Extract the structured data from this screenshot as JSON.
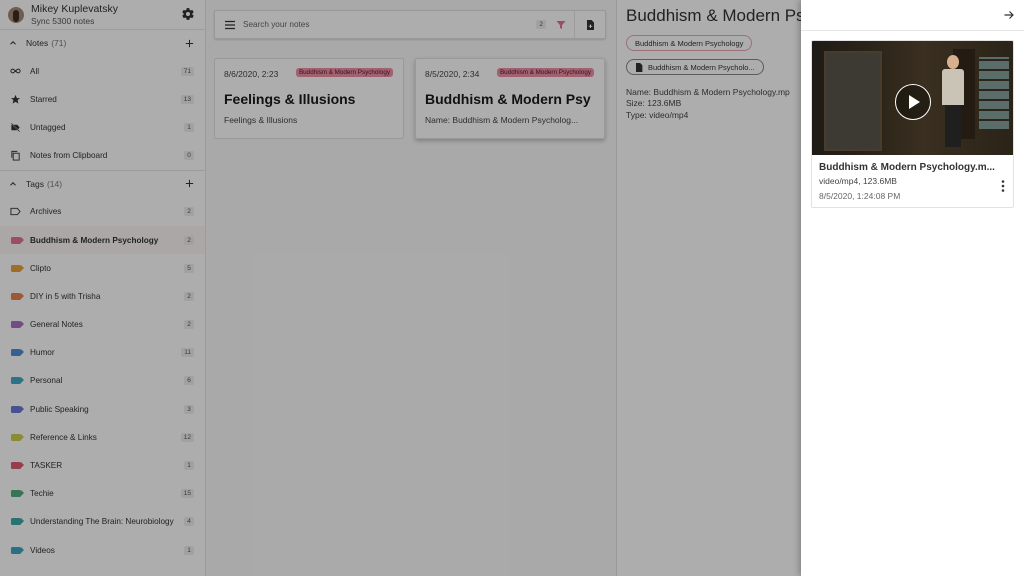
{
  "sidebar": {
    "profile": {
      "name": "Mikey Kuplevatsky",
      "sync": "Sync 5300 notes"
    },
    "notes_section": {
      "label": "Notes",
      "count": "(71)"
    },
    "notes_items": [
      {
        "label": "All",
        "count": "71",
        "icon": "infinity-icon"
      },
      {
        "label": "Starred",
        "count": "13",
        "icon": "star-icon"
      },
      {
        "label": "Untagged",
        "count": "1",
        "icon": "untagged-icon"
      },
      {
        "label": "Notes from Clipboard",
        "count": "0",
        "icon": "clipboard-icon"
      }
    ],
    "tags_section": {
      "label": "Tags",
      "count": "(14)"
    },
    "tags": [
      {
        "label": "Archives",
        "count": "2",
        "color": ""
      },
      {
        "label": "Buddhism & Modern Psychology",
        "count": "2",
        "color": "#e57390"
      },
      {
        "label": "Clipto",
        "count": "5",
        "color": "#e9a23b"
      },
      {
        "label": "DIY in 5 with Trisha",
        "count": "2",
        "color": "#e8834f"
      },
      {
        "label": "General Notes",
        "count": "2",
        "color": "#a770c9"
      },
      {
        "label": "Humor",
        "count": "11",
        "color": "#4f8fd6"
      },
      {
        "label": "Personal",
        "count": "6",
        "color": "#44a8c4"
      },
      {
        "label": "Public Speaking",
        "count": "3",
        "color": "#6a79d6"
      },
      {
        "label": "Reference & Links",
        "count": "12",
        "color": "#cbcf4a"
      },
      {
        "label": "TASKER",
        "count": "1",
        "color": "#e05a70"
      },
      {
        "label": "Techie",
        "count": "15",
        "color": "#4fae7c"
      },
      {
        "label": "Understanding The Brain: Neurobiology",
        "count": "4",
        "color": "#3fa7a8"
      },
      {
        "label": "Videos",
        "count": "1",
        "color": "#3fa6c4"
      }
    ]
  },
  "search": {
    "placeholder": "Search your notes",
    "count": "2"
  },
  "cards": [
    {
      "date": "8/6/2020, 2:23",
      "tag": "Buddhism & Modern Psychology",
      "title": "Feelings & Illusions",
      "body": "Feelings & Illusions"
    },
    {
      "date": "8/5/2020, 2:34",
      "tag": "Buddhism & Modern Psychology",
      "title": "Buddhism & Modern Psy",
      "body": "Name: Buddhism & Modern Psycholog..."
    }
  ],
  "detail": {
    "title": "Buddhism & Modern Ps",
    "tag_chip": "Buddhism & Modern Psychology",
    "file_chip": "Buddhism & Modern Psycholo...",
    "meta_name": "Name: Buddhism & Modern Psychology.mp",
    "meta_size": "Size: 123.6MB",
    "meta_type": "Type: video/mp4"
  },
  "attachment": {
    "name": "Buddhism & Modern Psychology.m...",
    "type_size": "video/mp4,  123.6MB",
    "date": "8/5/2020, 1:24:08 PM"
  },
  "colors": {
    "accent_pink": "#e57390",
    "tag_chip_bg": "#ef8fa6",
    "overlay": "rgba(0,0,0,0.32)"
  }
}
